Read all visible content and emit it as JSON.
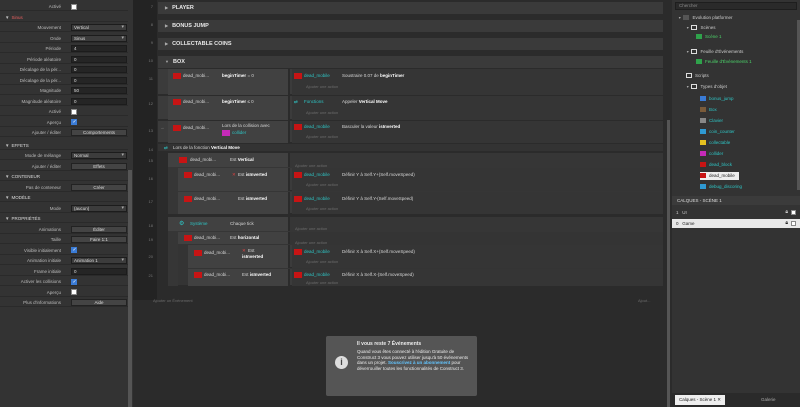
{
  "left_panel": {
    "rows1": [
      {
        "label": "Activé",
        "type": "check",
        "on": false
      },
      {
        "label": "Sinus",
        "type": "section-red"
      },
      {
        "label": "Mouvement",
        "type": "select",
        "value": "Vertical"
      },
      {
        "label": "Onde",
        "type": "select",
        "value": "Sinus"
      },
      {
        "label": "Période",
        "type": "input",
        "value": "4"
      },
      {
        "label": "Période aléatoire",
        "type": "input",
        "value": "0"
      },
      {
        "label": "Décalage de la pér...",
        "type": "input",
        "value": "0"
      },
      {
        "label": "Décalage de la pér...",
        "type": "input",
        "value": "0"
      },
      {
        "label": "Magnitude",
        "type": "input",
        "value": "50"
      },
      {
        "label": "Magnitude aléatoire",
        "type": "input",
        "value": "0"
      },
      {
        "label": "Activé",
        "type": "check",
        "on": false
      },
      {
        "label": "Aperçu",
        "type": "check",
        "on": true
      },
      {
        "label": "Ajouter / éditer",
        "type": "button",
        "value": "Comportements"
      }
    ],
    "effects": {
      "title": "EFFETS",
      "blend_label": "Mode de mélange",
      "blend_value": "Normal",
      "add_label": "Ajouter / éditer",
      "add_value": "Effets"
    },
    "container": {
      "title": "CONTENEUR",
      "label": "Pas de conteneur",
      "value": "Créer"
    },
    "model": {
      "title": "MODÈLE",
      "label": "Mode",
      "value": "(aucun)"
    },
    "props": {
      "title": "PROPRIÉTÉS",
      "rows": [
        {
          "label": "Animations",
          "type": "button",
          "value": "Éditer"
        },
        {
          "label": "Taille",
          "type": "button",
          "value": "Faire 1:1"
        },
        {
          "label": "Visible initialement",
          "type": "check",
          "on": true
        },
        {
          "label": "Animation initiale",
          "type": "select",
          "value": "Animation 1"
        },
        {
          "label": "Frame initiale",
          "type": "input",
          "value": "0"
        },
        {
          "label": "Activer les collisions",
          "type": "check",
          "on": true
        },
        {
          "label": "Aperçu",
          "type": "check",
          "on": false
        },
        {
          "label": "Plus d'informations",
          "type": "button",
          "value": "Aide"
        }
      ]
    }
  },
  "event_sheet": {
    "groups": [
      "PLAYER",
      "BONUS JUMP",
      "COLLECTABLE COINS",
      "BOX"
    ],
    "line_numbers": [
      "7",
      "8",
      "9",
      "10",
      "11",
      "12",
      "13",
      "14",
      "15",
      "16",
      "17",
      "18",
      "19",
      "20",
      "21",
      "22",
      "23"
    ],
    "add_action": "Ajouter une action",
    "add_event": "Ajouter un Événement",
    "add_ellipsis": "Ajout...",
    "events": {
      "e1": {
        "obj": "dead_mobi...",
        "cond": "beginTimer",
        "op": "= 0",
        "act_obj": "dead_mobile",
        "act_text": "Soustraire 0.07 de ",
        "act_bold": "beginTimer"
      },
      "e2": {
        "obj": "dead_mobi...",
        "cond": "beginTimer",
        "op": "≤ 0",
        "act_obj": "Fonctions",
        "act_text": "Appeler ",
        "act_bold": "Vertical Move"
      },
      "e3": {
        "obj": "dead_mobi...",
        "cond_pre": "Lors de la collision avec",
        "cond_obj": "collider",
        "act_obj": "dead_mobile",
        "act_text": "Basculer la valeur ",
        "act_bold": "isInverted"
      },
      "fn": {
        "text": "Lors de la fonction ",
        "bold": "Vertical Move"
      },
      "e4": {
        "obj": "dead_mobi...",
        "cond_pre": "Est ",
        "cond_bold": "Vertical"
      },
      "e5": {
        "obj": "dead_mobi...",
        "cond_pre": "Est ",
        "cond_bold": "isInverted",
        "act_obj": "dead_mobile",
        "act_text": "Définir Y à Self.Y+(Self.moveSpeed)"
      },
      "e6": {
        "obj": "dead_mobi...",
        "cond_pre": "Est ",
        "cond_bold": "isInverted",
        "act_obj": "dead_mobile",
        "act_text": "Définir Y à Self.Y-(Self.moveSpeed)"
      },
      "e7": {
        "obj": "Système",
        "cond_pre": "Chaque tick"
      },
      "e8": {
        "obj": "dead_mobi...",
        "cond_pre": "Est ",
        "cond_bold": "horizontal"
      },
      "e9": {
        "obj": "dead_mobi...",
        "cond_pre": "Est",
        "cond_bold": "isInverted",
        "act_obj": "dead_mobile",
        "act_text": "Définir X à Self.X+(Self.moveSpeed)"
      },
      "e10": {
        "obj": "dead_mobi...",
        "cond_pre": "Est ",
        "cond_bold": "isInverted",
        "act_obj": "dead_mobile",
        "act_text": "Définir X à Self.X-(Self.moveSpeed)"
      }
    }
  },
  "notice": {
    "title": "Il vous reste 7 Événements",
    "body_pre": "Quand vous êtes connecté à l'édition Gratuite de Construct 3 vous pouvez utiliser jusqu'à 50 événements dans un projet. ",
    "link": "Souscrivez à un abonnement",
    "body_post": " pour déverrouiller toutes les fonctionnalités de Construct 3."
  },
  "project": {
    "search_placeholder": "Chercher",
    "root": "Evolution platformer",
    "scenes": "Scènes",
    "scene1": "Scène 1",
    "sheets": "Feuille d'Événements",
    "sheet1": "Feuille d'Événements 1",
    "scripts": "Scripts",
    "objtypes": "Types d'objet",
    "objects": [
      {
        "name": "bonus_jump",
        "color": "#3a7bd5"
      },
      {
        "name": "Box",
        "color": "#7a5b3a"
      },
      {
        "name": "Clavier",
        "color": "#888888"
      },
      {
        "name": "coin_counter",
        "color": "#2f9ad3"
      },
      {
        "name": "collectable",
        "color": "#e5c120"
      },
      {
        "name": "collider",
        "color": "#c52ab8"
      },
      {
        "name": "dead_block",
        "color": "#c71414"
      },
      {
        "name": "dead_mobile",
        "color": "#c71414"
      },
      {
        "name": "debug_discoring",
        "color": "#2f9ad3"
      }
    ]
  },
  "layers": {
    "header": "CALQUES - SCÈNE 1",
    "items": [
      {
        "num": "1",
        "name": "UI"
      },
      {
        "num": "0",
        "name": "Game"
      }
    ]
  },
  "bottom_tabs": {
    "active": "Calques - Scène 1",
    "other": "Galerie"
  }
}
